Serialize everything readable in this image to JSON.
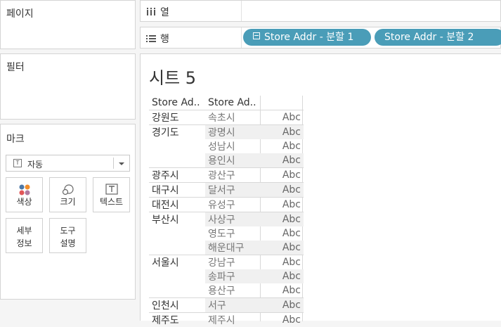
{
  "pages": {
    "title": "페이지"
  },
  "filters": {
    "title": "필터"
  },
  "marks": {
    "title": "마크",
    "type_select": "자동",
    "cards": [
      {
        "label": "색상",
        "icon": "color-icon"
      },
      {
        "label": "크기",
        "icon": "size-icon"
      },
      {
        "label": "텍스트",
        "icon": "text-icon"
      },
      {
        "label": "세부\n정보",
        "line1": "세부",
        "line2": "정보",
        "icon": "detail-icon"
      },
      {
        "label": "도구\n설명",
        "line1": "도구",
        "line2": "설명",
        "icon": "tooltip-icon"
      }
    ]
  },
  "shelves": {
    "columns_label": "열",
    "rows_label": "행",
    "row_pills": [
      "Store Addr - 분할 1",
      "Store Addr - 분할 2"
    ]
  },
  "sheet": {
    "title": "시트 5",
    "headers": [
      "Store Ad..",
      "Store Ad.."
    ],
    "cell_text": "Abc",
    "rows": [
      {
        "r1": "강원도",
        "r2": "속초시"
      },
      {
        "r1": "경기도",
        "r2": "광명시"
      },
      {
        "r1": "",
        "r2": "성남시"
      },
      {
        "r1": "",
        "r2": "용인시"
      },
      {
        "r1": "광주시",
        "r2": "광산구"
      },
      {
        "r1": "대구시",
        "r2": "달서구"
      },
      {
        "r1": "대전시",
        "r2": "유성구"
      },
      {
        "r1": "부산시",
        "r2": "사상구"
      },
      {
        "r1": "",
        "r2": "영도구"
      },
      {
        "r1": "",
        "r2": "해운대구"
      },
      {
        "r1": "서울시",
        "r2": "강남구"
      },
      {
        "r1": "",
        "r2": "송파구"
      },
      {
        "r1": "",
        "r2": "용산구"
      },
      {
        "r1": "인천시",
        "r2": "서구"
      },
      {
        "r1": "제주도",
        "r2": "제주시"
      }
    ],
    "row_cells": [
      "Abc",
      "Abc",
      "Abc",
      "Abc",
      "Abc",
      "Abc",
      "Abc",
      "Abc",
      "Abc",
      "Abc",
      "Abc",
      "Abc",
      "Abc",
      "Abc",
      "Abc"
    ]
  }
}
